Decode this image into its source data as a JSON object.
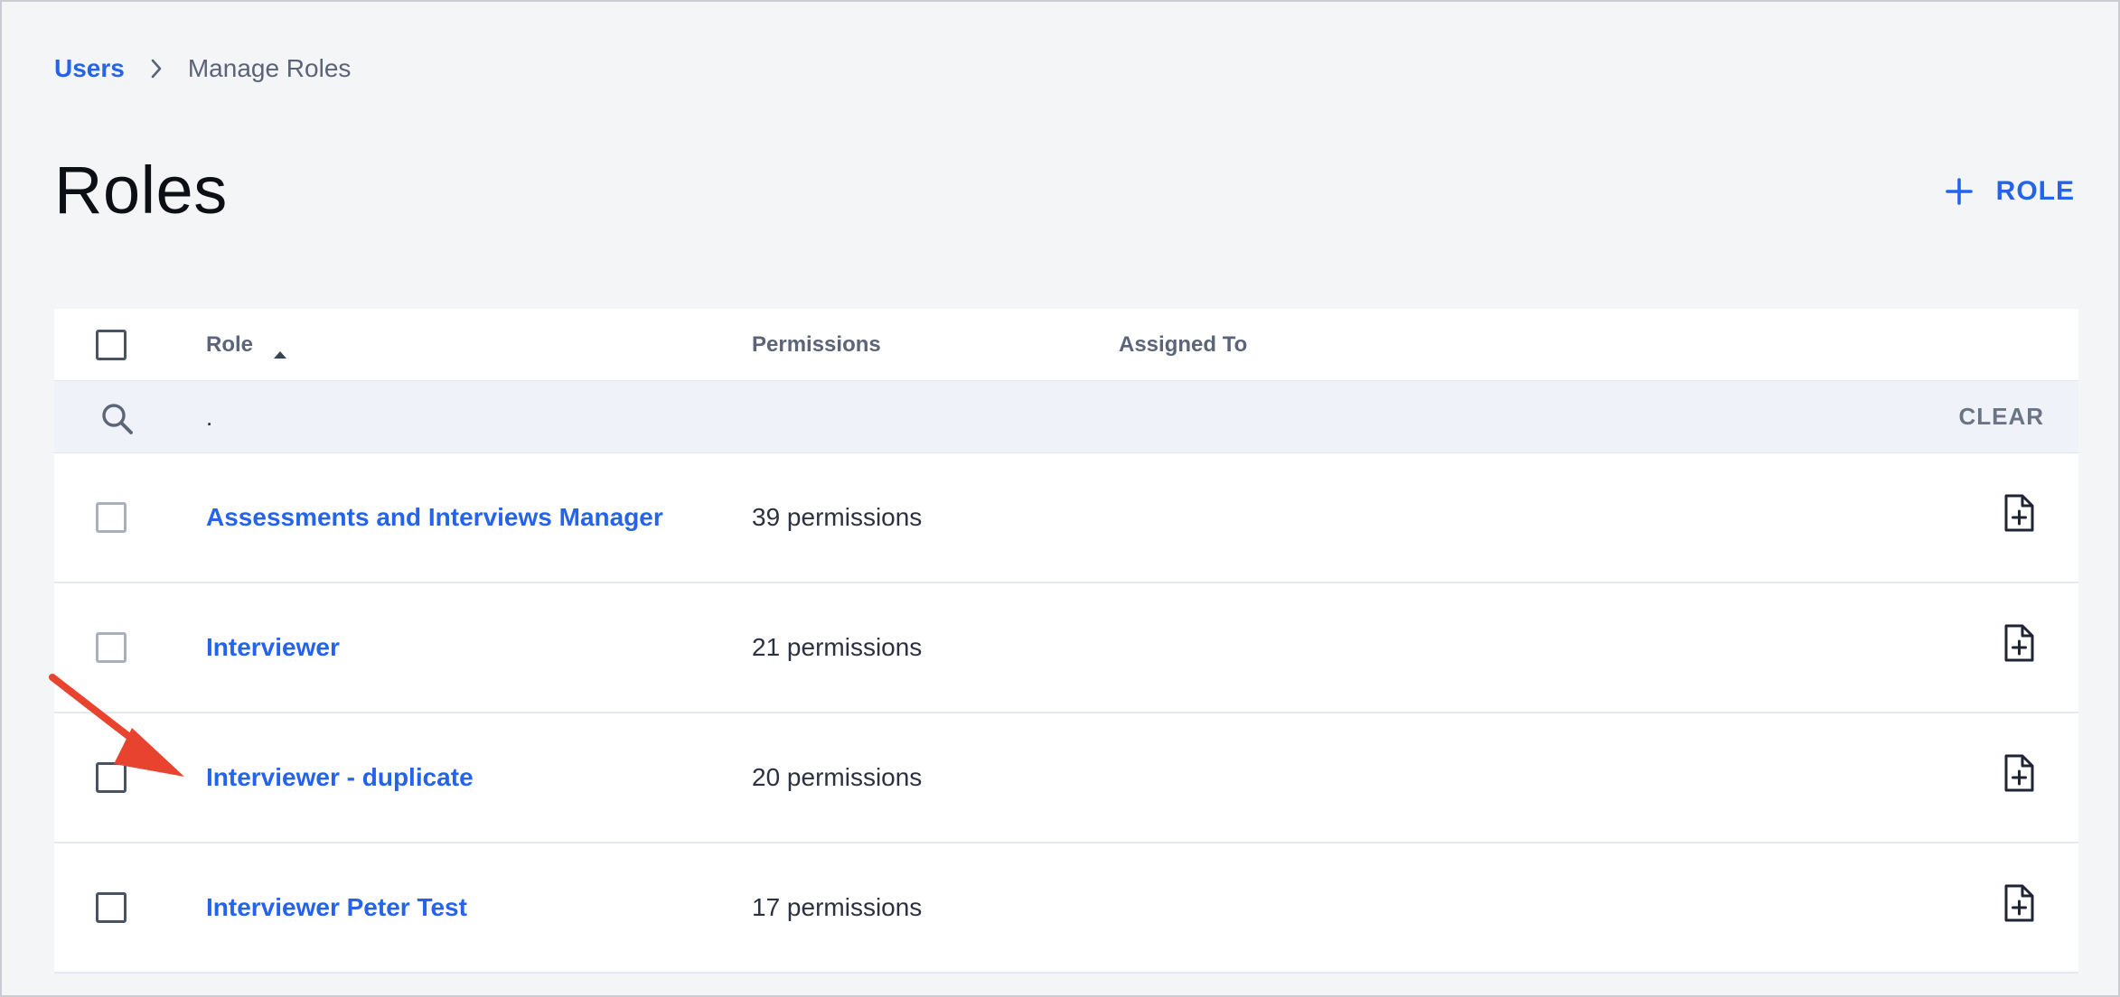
{
  "breadcrumb": {
    "parent": "Users",
    "current": "Manage Roles"
  },
  "page": {
    "title": "Roles",
    "add_role_label": "ROLE"
  },
  "table": {
    "columns": {
      "role": "Role",
      "permissions": "Permissions",
      "assigned_to": "Assigned To"
    },
    "filter": {
      "value": ".",
      "clear_label": "CLEAR"
    },
    "rows": [
      {
        "role": "Assessments and Interviews Manager",
        "permissions": "39 permissions"
      },
      {
        "role": "Interviewer",
        "permissions": "21 permissions"
      },
      {
        "role": "Interviewer - duplicate",
        "permissions": "20 permissions"
      },
      {
        "role": "Interviewer Peter Test",
        "permissions": "17 permissions"
      }
    ]
  },
  "icons": {
    "breadcrumb_separator": "chevron-right-icon",
    "add": "plus-icon",
    "sort": "sort-ascending-icon",
    "search": "search-icon",
    "row_action": "file-plus-icon",
    "annotation": "red-arrow-annotation"
  },
  "colors": {
    "accent": "#2563eb",
    "annotation": "#e8432e",
    "background": "#f4f5f7",
    "filter_row": "#eff2f8"
  }
}
